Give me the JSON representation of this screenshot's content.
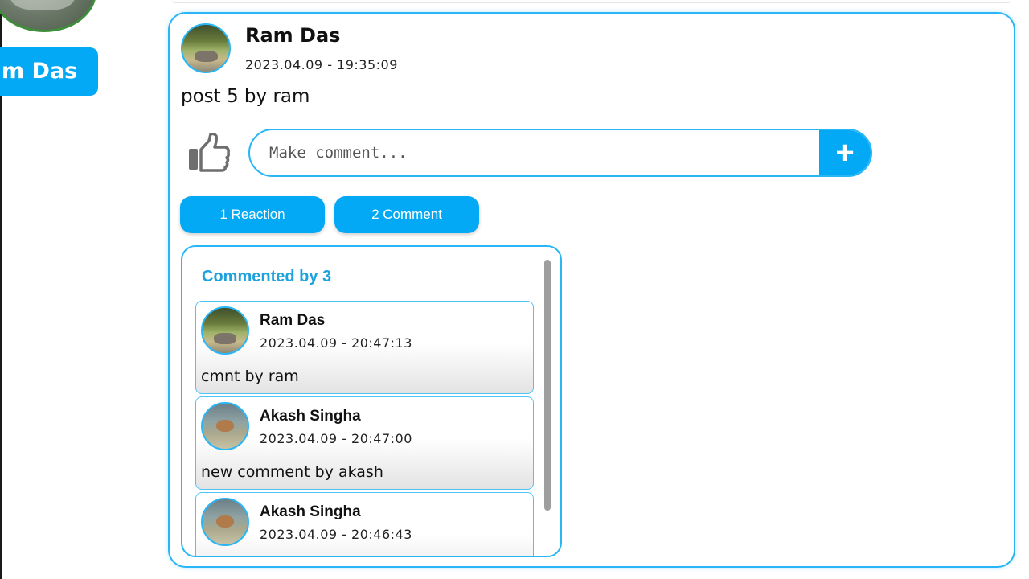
{
  "sidebar": {
    "name_label": "m Das"
  },
  "post": {
    "author": "Ram Das",
    "date": "2023.04.09 - 19:35:09",
    "body": "post 5 by ram",
    "comment_placeholder": "Make comment...",
    "add_label": "+",
    "reaction_label": "1 Reaction",
    "comment_count_label": "2 Comment"
  },
  "comments": {
    "title": "Commented by 3",
    "items": [
      {
        "name": "Ram Das",
        "date": "2023.04.09 - 20:47:13",
        "text": "cmnt by ram",
        "avatar": "forest"
      },
      {
        "name": "Akash Singha",
        "date": "2023.04.09 - 20:47:00",
        "text": "new comment by akash",
        "avatar": "deer"
      },
      {
        "name": "Akash Singha",
        "date": "2023.04.09 - 20:46:43",
        "text": "",
        "avatar": "deer"
      }
    ]
  },
  "colors": {
    "accent": "#03a9f4",
    "border": "#29b6f6"
  }
}
